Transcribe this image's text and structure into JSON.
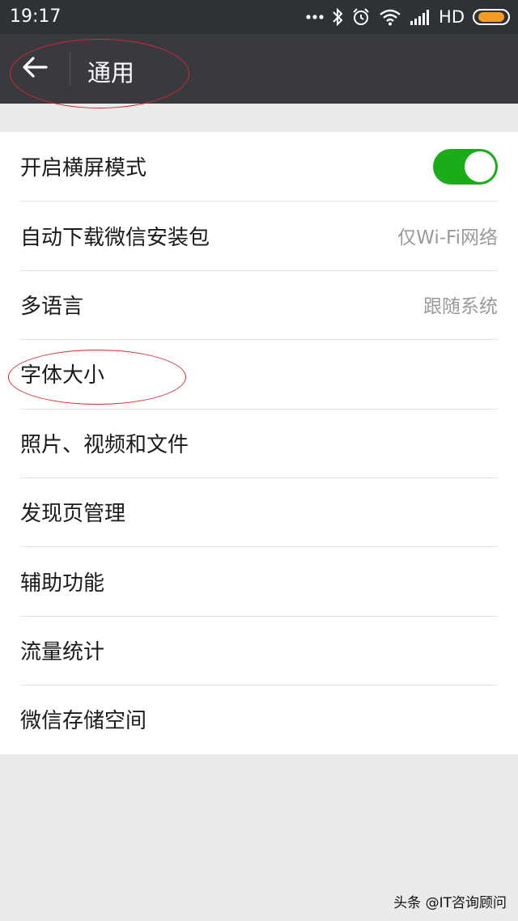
{
  "status_bar": {
    "time": "19:17",
    "network": "HD",
    "battery_level": 0.85,
    "icons": [
      "more-dots-icon",
      "bluetooth-icon",
      "alarm-icon",
      "wifi-icon",
      "signal-icon",
      "battery-icon"
    ]
  },
  "app_bar": {
    "title": "通用",
    "back_icon": "arrow-left-icon"
  },
  "settings": {
    "landscape": {
      "label": "开启横屏模式",
      "enabled": true
    },
    "auto_download": {
      "label": "自动下载微信安装包",
      "value": "仅Wi-Fi网络"
    },
    "language": {
      "label": "多语言",
      "value": "跟随系统"
    },
    "font_size": {
      "label": "字体大小"
    },
    "media": {
      "label": "照片、视频和文件"
    },
    "discover": {
      "label": "发现页管理"
    },
    "accessibility": {
      "label": "辅助功能"
    },
    "traffic": {
      "label": "流量统计"
    },
    "storage": {
      "label": "微信存储空间"
    }
  },
  "watermark": "头条 @IT咨询顾问",
  "colors": {
    "status_bar": "#2e3136",
    "app_bar": "#393a3f",
    "toggle_on": "#1aad19",
    "annotation": "#d8282e",
    "battery": "#f59b23"
  }
}
